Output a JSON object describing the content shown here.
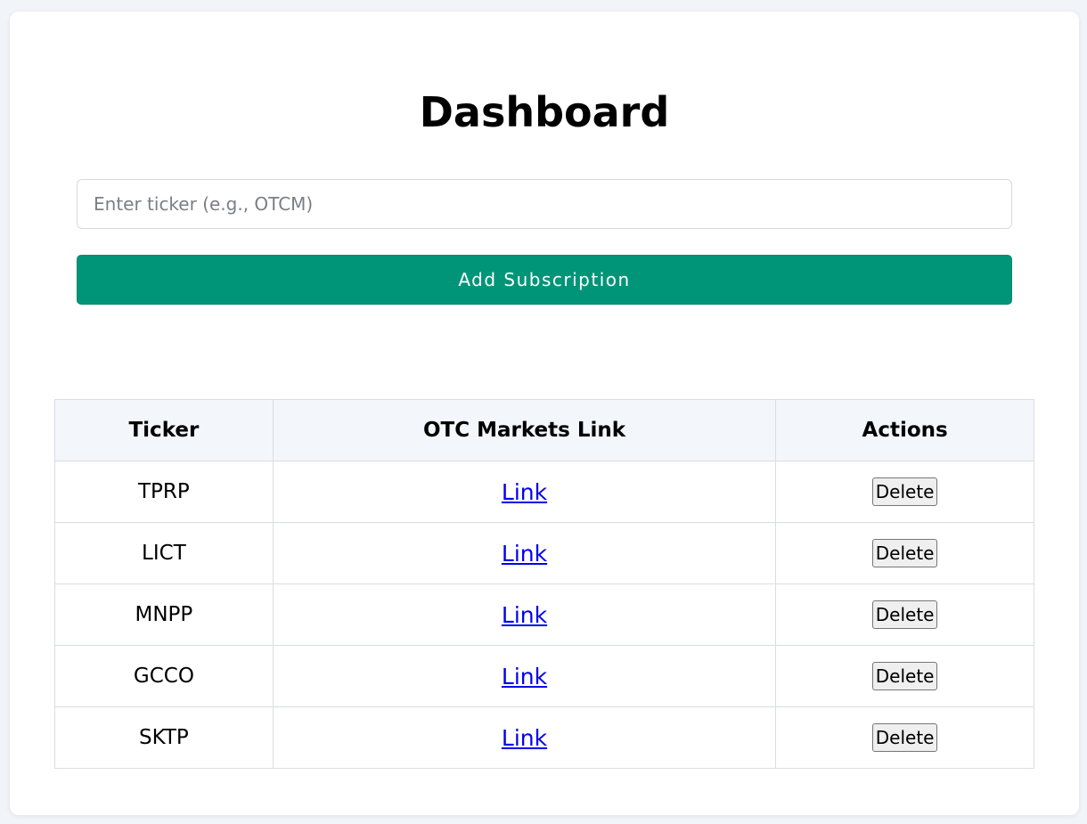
{
  "page": {
    "title": "Dashboard"
  },
  "form": {
    "ticker_placeholder": "Enter ticker (e.g., OTCM)",
    "ticker_value": "",
    "add_button_label": "Add Subscription"
  },
  "table": {
    "headers": [
      "Ticker",
      "OTC Markets Link",
      "Actions"
    ],
    "rows": [
      {
        "ticker": "TPRP",
        "link_label": "Link",
        "action_label": "Delete"
      },
      {
        "ticker": "LICT",
        "link_label": "Link",
        "action_label": "Delete"
      },
      {
        "ticker": "MNPP",
        "link_label": "Link",
        "action_label": "Delete"
      },
      {
        "ticker": "GCCO",
        "link_label": "Link",
        "action_label": "Delete"
      },
      {
        "ticker": "SKTP",
        "link_label": "Link",
        "action_label": "Delete"
      }
    ]
  },
  "colors": {
    "accent": "#009578",
    "page_background": "#f1f4f9",
    "header_background": "#f3f6fa",
    "link": "#0000ee"
  }
}
